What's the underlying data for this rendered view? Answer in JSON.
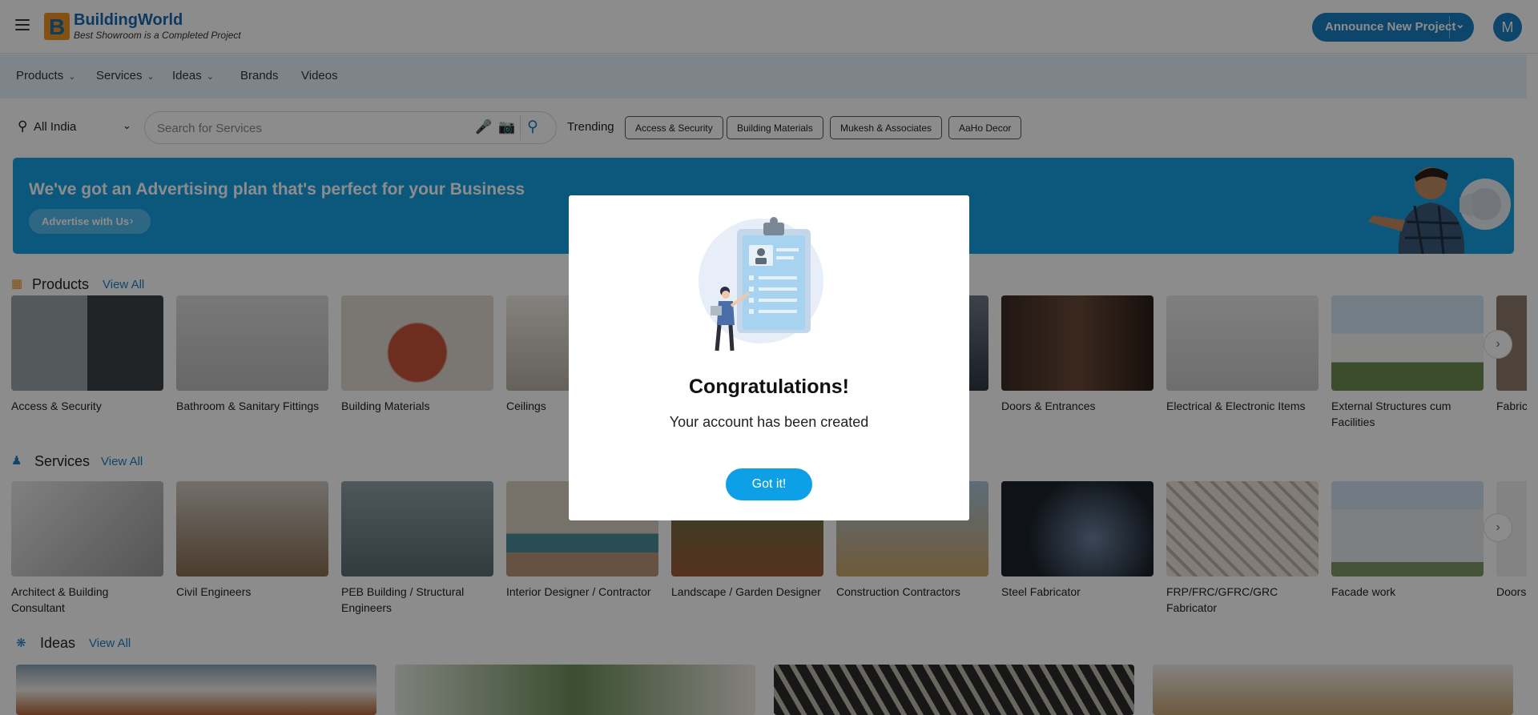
{
  "header": {
    "brand_name": "BuildingWorld",
    "brand_tagline": "Best Showroom is a Completed Project",
    "announce_label": "Announce New Project",
    "avatar_initial": "M"
  },
  "nav": {
    "items": [
      {
        "label": "Products",
        "has_dropdown": true
      },
      {
        "label": "Services",
        "has_dropdown": true
      },
      {
        "label": "Ideas",
        "has_dropdown": true
      },
      {
        "label": "Brands",
        "has_dropdown": false
      },
      {
        "label": "Videos",
        "has_dropdown": false
      }
    ]
  },
  "search": {
    "location": "All India",
    "placeholder": "Search for Services",
    "trending_label": "Trending",
    "trending": [
      "Access & Security",
      "Building Materials",
      "Mukesh & Associates",
      "AaHo Decor"
    ]
  },
  "banner": {
    "headline": "We've got an Advertising plan that's perfect for your Business",
    "button_label": "Advertise with Us"
  },
  "products": {
    "title": "Products",
    "view_all": "View All",
    "items": [
      "Access & Security",
      "Bathroom & Sanitary Fittings",
      "Building Materials",
      "Ceilings",
      "",
      "",
      "Doors & Entrances",
      "Electrical & Electronic Items",
      "External Structures cum Facilities",
      "Fabric"
    ]
  },
  "services": {
    "title": "Services",
    "view_all": "View All",
    "items": [
      "Architect & Building Consultant",
      "Civil Engineers",
      "PEB Building / Structural Engineers",
      "Interior Designer / Contractor",
      "Landscape / Garden Designer",
      "Construction Contractors",
      "Steel Fabricator",
      "FRP/FRC/GFRC/GRC Fabricator",
      "Facade work",
      "Doors"
    ]
  },
  "ideas": {
    "title": "Ideas",
    "view_all": "View All"
  },
  "modal": {
    "title": "Congratulations!",
    "message": "Your account has been created",
    "button_label": "Got it!"
  },
  "colors": {
    "brand_blue": "#1b7fc4",
    "banner_blue": "#17a1e3",
    "nav_bg": "#e6f3fb",
    "modal_button": "#0ea0e6"
  }
}
